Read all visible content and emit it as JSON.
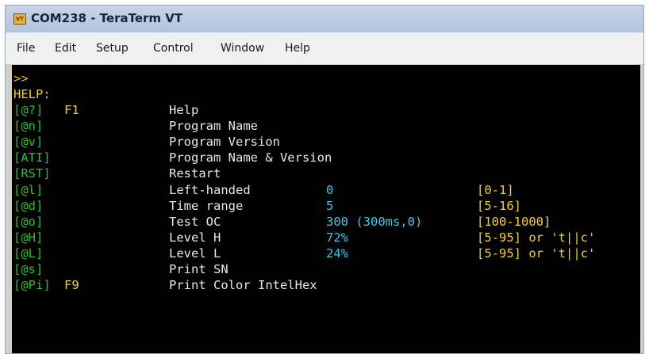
{
  "window": {
    "title": "COM238 - TeraTerm VT",
    "icon": "teraterm-app-icon",
    "icon_text": "VT"
  },
  "menu": [
    "File",
    "Edit",
    "Setup",
    "Control",
    "Window",
    "Help"
  ],
  "terminal": {
    "prompt": ">>",
    "heading": "HELP:",
    "commands": [
      {
        "key": "[@?]",
        "fkey": "F1",
        "desc": "Help",
        "value": "",
        "range": ""
      },
      {
        "key": "[@n]",
        "fkey": "",
        "desc": "Program Name",
        "value": "",
        "range": ""
      },
      {
        "key": "[@v]",
        "fkey": "",
        "desc": "Program Version",
        "value": "",
        "range": ""
      },
      {
        "key": "[ATI]",
        "fkey": "",
        "desc": "Program Name & Version",
        "value": "",
        "range": ""
      },
      {
        "key": "[RST]",
        "fkey": "",
        "desc": "Restart",
        "value": "",
        "range": ""
      },
      {
        "key": "[@l]",
        "fkey": "",
        "desc": "Left-handed",
        "value": "0",
        "range": "[0-1]"
      },
      {
        "key": "[@d]",
        "fkey": "",
        "desc": "Time range",
        "value": "5",
        "range": "[5-16]"
      },
      {
        "key": "[@o]",
        "fkey": "",
        "desc": "Test OC",
        "value": "300 (300ms,0)",
        "range": "[100-1000]"
      },
      {
        "key": "[@H]",
        "fkey": "",
        "desc": "Level H",
        "value": "72%",
        "range": "[5-95] or 't||c'"
      },
      {
        "key": "[@L]",
        "fkey": "",
        "desc": "Level L",
        "value": "24%",
        "range": "[5-95] or 't||c'"
      },
      {
        "key": "[@s]",
        "fkey": "",
        "desc": "Print SN",
        "value": "",
        "range": ""
      },
      {
        "key": "[@Pi]",
        "fkey": "F9",
        "desc": "Print Color IntelHex",
        "value": "",
        "range": ""
      }
    ]
  },
  "colors": {
    "terminal_bg": "#000000",
    "prompt": "#f0b030",
    "command_key": "#2fbf2f",
    "description": "#e8e8e8",
    "value": "#3ec8e8",
    "range": "#f0d040"
  }
}
